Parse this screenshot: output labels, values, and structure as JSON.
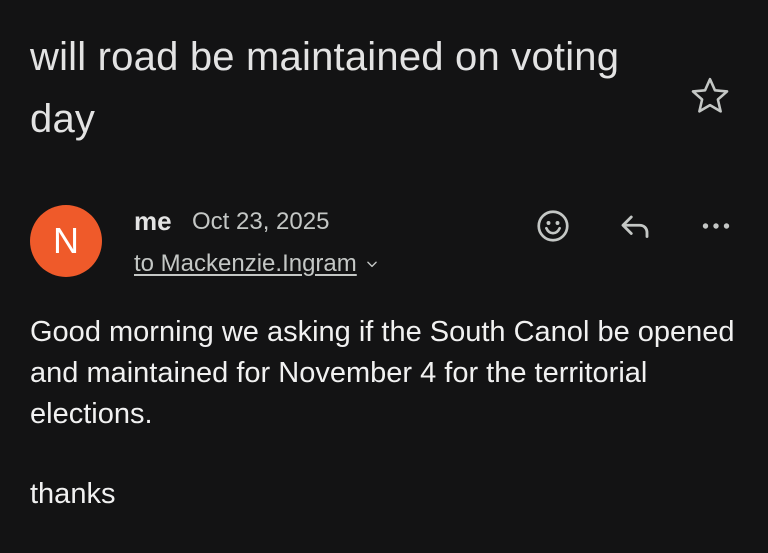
{
  "email": {
    "subject": "will road be maintained on voting day",
    "sender": {
      "initial": "N",
      "avatar_color": "#ef5a2a",
      "name": "me",
      "date": "Oct 23, 2025"
    },
    "recipient_line": "to Mackenzie.Ingram",
    "body": "Good morning we asking if the South Canol be opened and maintained for November 4 for the territorial elections.",
    "sign_off": "thanks"
  },
  "actions": {
    "star_icon": "star-outline-icon",
    "emoji_icon": "emoji-react-icon",
    "reply_icon": "reply-icon",
    "more_icon": "more-horizontal-icon",
    "recipient_expand_icon": "chevron-down-icon"
  },
  "colors": {
    "background": "#131314",
    "text": "#e3e3e3",
    "muted_text": "#c4c7c5"
  }
}
